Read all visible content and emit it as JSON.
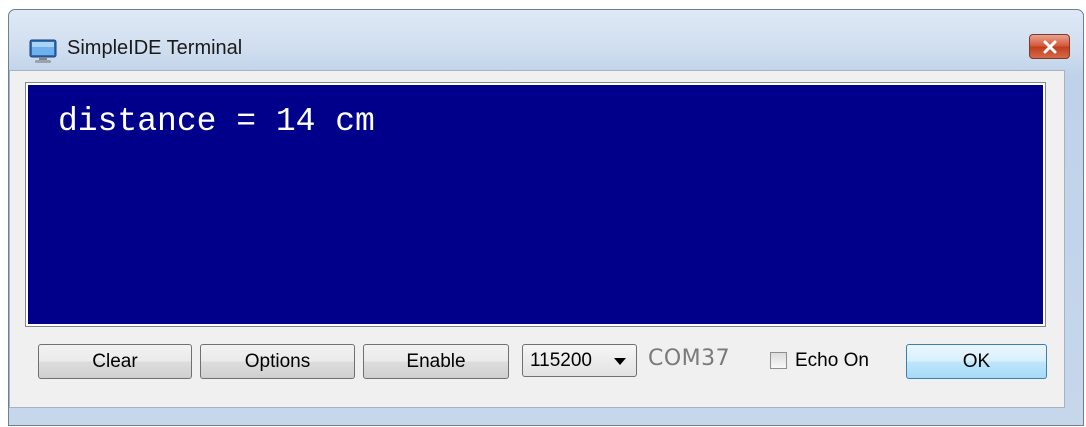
{
  "window": {
    "title": "SimpleIDE Terminal",
    "close_icon": "close-x-icon",
    "app_icon": "monitor-icon"
  },
  "terminal": {
    "output": "distance = 14 cm",
    "background_color": "#00008b",
    "text_color": "#ffffff"
  },
  "toolbar": {
    "clear_label": "Clear",
    "options_label": "Options",
    "enable_label": "Enable",
    "baud_rate": "115200",
    "port": "COM37",
    "echo_label": "Echo On",
    "echo_checked": false,
    "ok_label": "OK"
  }
}
